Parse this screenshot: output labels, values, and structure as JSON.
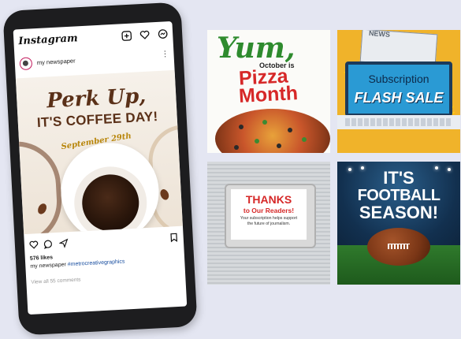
{
  "instagram": {
    "app_name": "Instagram",
    "handle": "my newspaper",
    "post": {
      "headline_line1": "Perk Up,",
      "headline_line2": "IT'S COFFEE DAY!",
      "date": "September 29th"
    },
    "likes": "576 likes",
    "caption_user": "my newspaper",
    "caption_tag": "#metrocreativegraphics",
    "comments_link": "View all 55 comments"
  },
  "tiles": {
    "pizza": {
      "yum": "Yum,",
      "october": "October is",
      "pizza": "Pizza",
      "month": "Month"
    },
    "subscription": {
      "news_label": "NEWS",
      "line1": "Subscription",
      "line2": "FLASH SALE"
    },
    "thanks": {
      "line1": "THANKS",
      "line2": "to Our Readers!",
      "note": "Your subscription helps support the future of journalism."
    },
    "football": {
      "line1": "IT'S",
      "line2": "FOOTBALL",
      "line3": "SEASON!"
    }
  },
  "colors": {
    "background": "#e4e6f2",
    "phone": "#1d1d1f",
    "pizza_red": "#d62828",
    "pizza_green": "#2e8b2e",
    "subscription_yellow": "#f0b32a",
    "football_navy": "#0d2238",
    "coffee_brown": "#5a3018"
  },
  "icons": [
    "new-post-icon",
    "heart-icon",
    "messenger-icon",
    "more-icon",
    "like-icon",
    "comment-icon",
    "share-icon",
    "bookmark-icon"
  ]
}
